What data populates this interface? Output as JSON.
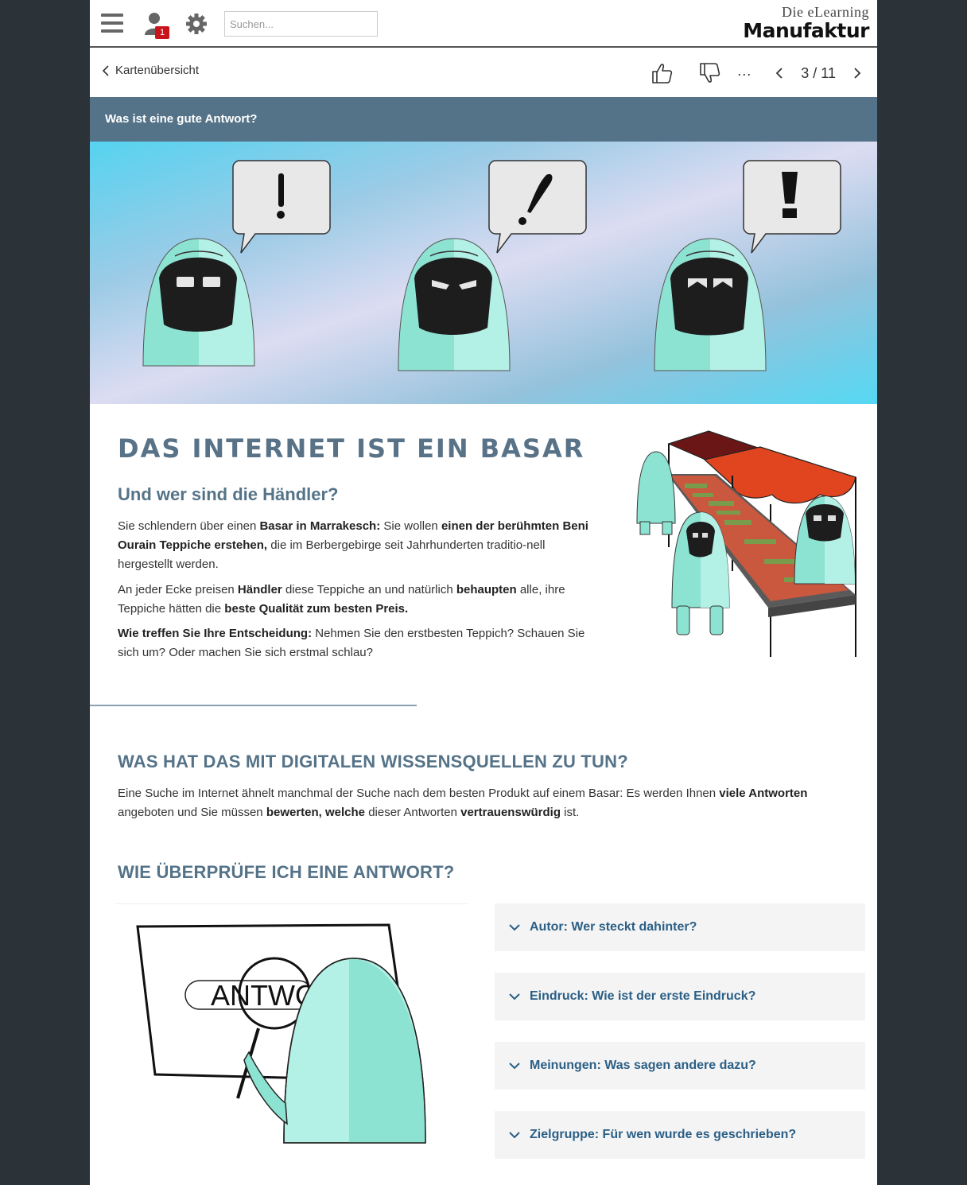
{
  "header": {
    "search_placeholder": "Suchen...",
    "notification_count": "1",
    "logo_top": "Die eLearning",
    "logo_main": "Manufaktur"
  },
  "nav": {
    "back_label": "Kartenübersicht",
    "more_label": "...",
    "counter": "3 / 11"
  },
  "card": {
    "title": "Was ist eine gute Antwort?"
  },
  "content": {
    "heading": "DAS INTERNET IST EIN BASAR",
    "subheading": "Und wer sind die Händler?",
    "p1": [
      {
        "t": "Sie schlendern über einen "
      },
      {
        "t": "Basar in Marrakesch:",
        "b": true
      },
      {
        "t": " Sie wollen "
      },
      {
        "t": "einen der berühmten Beni Ourain Teppiche erstehen,",
        "b": true
      },
      {
        "t": " die im Berbergebirge seit Jahrhunderten traditio-nell hergestellt werden."
      }
    ],
    "p2": [
      {
        "t": "An jeder Ecke preisen "
      },
      {
        "t": "Händler",
        "b": true
      },
      {
        "t": " diese Teppiche an und natürlich "
      },
      {
        "t": "behaupten",
        "b": true
      },
      {
        "t": " alle, ihre Teppiche hätten die "
      },
      {
        "t": "beste Qualität zum besten Preis.",
        "b": true
      }
    ],
    "p3": [
      {
        "t": "Wie treffen Sie Ihre Entscheidung:",
        "b": true
      },
      {
        "t": " Nehmen Sie den erstbesten Teppich? Schauen Sie sich um? Oder machen Sie sich erstmal schlau?"
      }
    ],
    "section2_heading": "WAS HAT DAS MIT DIGITALEN WISSENSQUELLEN ZU TUN?",
    "p4": [
      {
        "t": "Eine Suche im Internet ähnelt manchmal der Suche nach dem besten Produkt auf einem Basar: Es werden Ihnen "
      },
      {
        "t": "viele Antworten",
        "b": true
      },
      {
        "t": " angeboten und Sie müssen "
      },
      {
        "t": "bewerten, welche",
        "b": true
      },
      {
        "t": " dieser Antworten "
      },
      {
        "t": "vertrauenswürdig",
        "b": true
      },
      {
        "t": " ist."
      }
    ],
    "section3_heading": "WIE ÜBERPRÜFE ICH EINE ANTWORT?",
    "magnifier_text": "ANTWO"
  },
  "accordions": [
    {
      "label": "Autor: Wer steckt dahinter?"
    },
    {
      "label": "Eindruck: Wie ist der erste Eindruck?"
    },
    {
      "label": "Meinungen: Was sagen andere dazu?"
    },
    {
      "label": "Zielgruppe: Für wen wurde es geschrieben?"
    }
  ],
  "colors": {
    "accent": "#557388",
    "link": "#2b5f86",
    "mint": "#8de3d2",
    "badge": "#c9141b"
  }
}
